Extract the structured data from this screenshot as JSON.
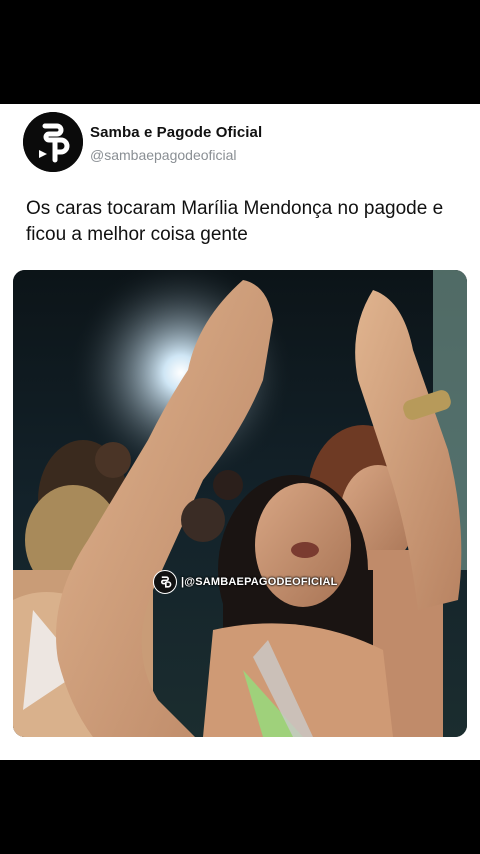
{
  "post": {
    "author_name": "Samba e Pagode Oficial",
    "author_handle": "@sambaepagodeoficial",
    "text": "Os caras tocaram Marília Mendonça no pagode e ficou a melhor coisa gente"
  },
  "media": {
    "watermark": "|@SAMBAEPAGODEOFICIAL",
    "icon": "concert-photo"
  },
  "colors": {
    "card_background": "#ffffff",
    "page_background": "#000000",
    "handle_gray": "#8a8f94"
  }
}
